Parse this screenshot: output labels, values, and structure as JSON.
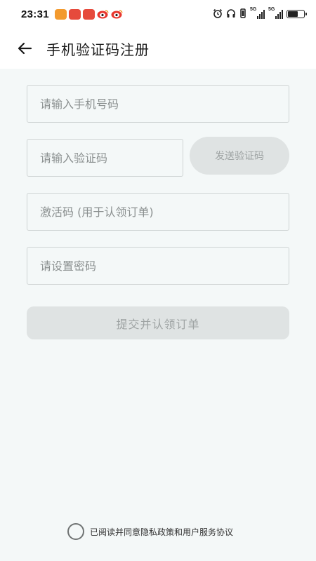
{
  "status_bar": {
    "time": "23:31",
    "network_1": "5G",
    "network_2": "5G",
    "battery_level": 0.6,
    "icons": [
      "alarm-icon",
      "headphones-icon",
      "vibrate-icon",
      "signal-icon",
      "signal-icon",
      "battery-icon"
    ]
  },
  "header": {
    "title": "手机验证码注册",
    "back_icon": "arrow-left-icon"
  },
  "form": {
    "phone_placeholder": "请输入手机号码",
    "code_placeholder": "请输入验证码",
    "send_code_label": "发送验证码",
    "activation_placeholder": "激活码 (用于认领订单)",
    "password_placeholder": "请设置密码",
    "submit_label": "提交并认领订单"
  },
  "agreement": {
    "text": "已阅读并同意隐私政策和用户服务协议",
    "checked": false
  },
  "colors": {
    "page_background": "#f4f8f8",
    "disabled_button": "#dfe3e3",
    "disabled_text": "#9ea3a3",
    "field_border": "#cfd4d4"
  }
}
